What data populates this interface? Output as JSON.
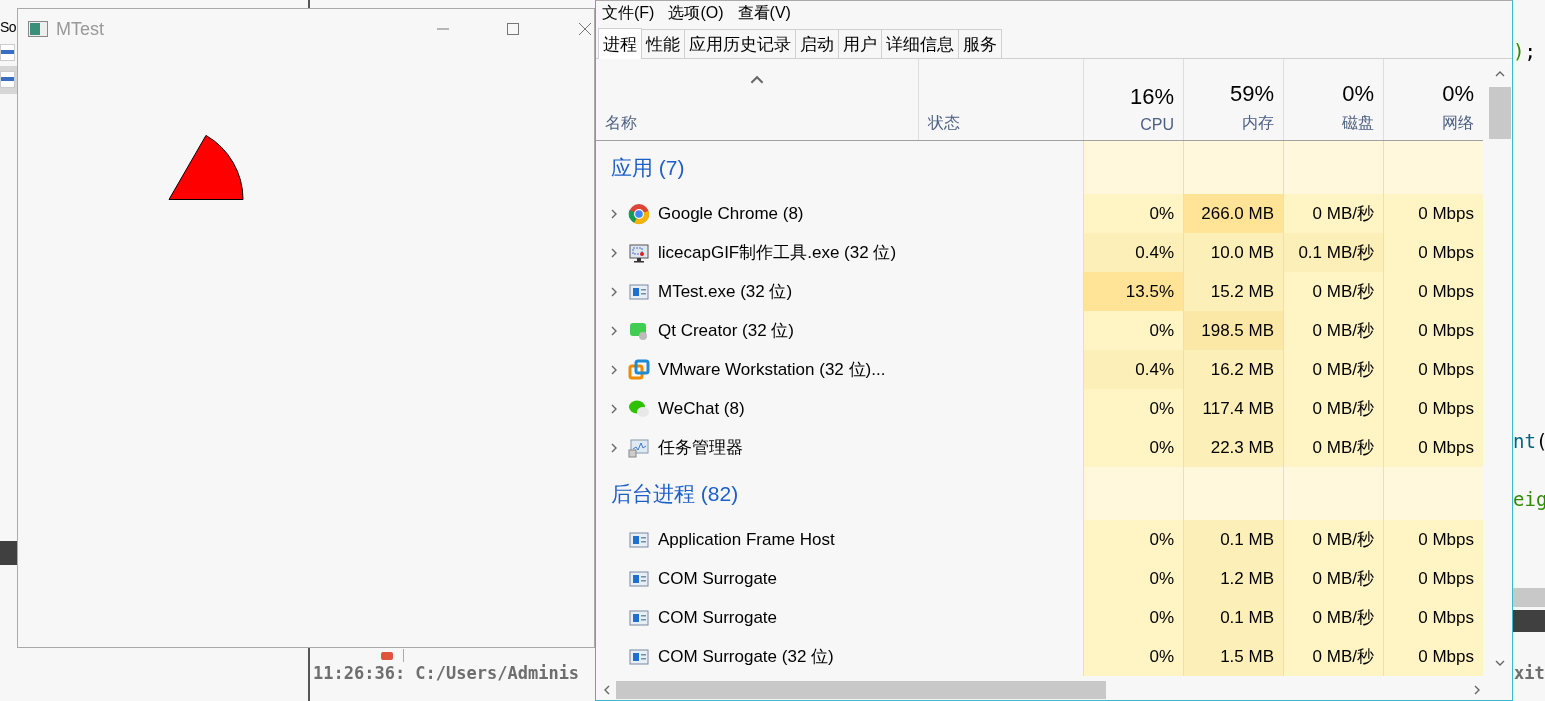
{
  "editor": {
    "sidebar_text": "So",
    "code_lines": [
      {
        "parts": [
          {
            "text": ")",
            "color": "#2e8b00"
          },
          {
            "text": ";",
            "color": "#000000"
          }
        ]
      },
      {
        "parts": [
          {
            "text": "nt",
            "color": "#00677c"
          },
          {
            "text": "(",
            "color": "#000000"
          }
        ]
      },
      {
        "parts": [
          {
            "text": "eig",
            "color": "#2e8b00"
          }
        ]
      }
    ],
    "output_line": "11:26:36: C:/Users/Adminis",
    "output_tail": "xit"
  },
  "mtest_window": {
    "title": "MTest"
  },
  "task_manager": {
    "menu": [
      "文件(F)",
      "选项(O)",
      "查看(V)"
    ],
    "tabs": [
      {
        "label": "进程",
        "selected": true
      },
      {
        "label": "性能",
        "selected": false
      },
      {
        "label": "应用历史记录",
        "selected": false
      },
      {
        "label": "启动",
        "selected": false
      },
      {
        "label": "用户",
        "selected": false
      },
      {
        "label": "详细信息",
        "selected": false
      },
      {
        "label": "服务",
        "selected": false
      }
    ],
    "columns": [
      {
        "label": "名称",
        "sorted": true
      },
      {
        "label": "状态",
        "sorted": false
      },
      {
        "label": "CPU",
        "total": "16%",
        "sorted": false
      },
      {
        "label": "内存",
        "total": "59%",
        "sorted": false
      },
      {
        "label": "磁盘",
        "total": "0%",
        "sorted": false
      },
      {
        "label": "网络",
        "total": "0%",
        "sorted": false
      }
    ],
    "groups": [
      {
        "title": "应用 (7)",
        "rows": [
          {
            "name": "Google Chrome (8)",
            "expandable": true,
            "cells": [
              {
                "text": "0%",
                "color": "#fff4c4"
              },
              {
                "text": "266.0 MB",
                "color": "#ffe497"
              },
              {
                "text": "0 MB/秒",
                "color": "#fff4c4"
              },
              {
                "text": "0 Mbps",
                "color": "#fff4c4"
              }
            ]
          },
          {
            "name": "licecapGIF制作工具.exe (32 位)",
            "expandable": true,
            "cells": [
              {
                "text": "0.4%",
                "color": "#fcefb8"
              },
              {
                "text": "10.0 MB",
                "color": "#fcefb8"
              },
              {
                "text": "0.1 MB/秒",
                "color": "#fcefb8"
              },
              {
                "text": "0 Mbps",
                "color": "#fff4c4"
              }
            ]
          },
          {
            "name": "MTest.exe (32 位)",
            "expandable": true,
            "cells": [
              {
                "text": "13.5%",
                "color": "#ffe497"
              },
              {
                "text": "15.2 MB",
                "color": "#fcefb8"
              },
              {
                "text": "0 MB/秒",
                "color": "#fff4c4"
              },
              {
                "text": "0 Mbps",
                "color": "#fff4c4"
              }
            ]
          },
          {
            "name": "Qt Creator (32 位)",
            "expandable": true,
            "cells": [
              {
                "text": "0%",
                "color": "#fff4c4"
              },
              {
                "text": "198.5 MB",
                "color": "#fbe8a6"
              },
              {
                "text": "0 MB/秒",
                "color": "#fff4c4"
              },
              {
                "text": "0 Mbps",
                "color": "#fff4c4"
              }
            ]
          },
          {
            "name": "VMware Workstation (32 位)...",
            "expandable": true,
            "cells": [
              {
                "text": "0.4%",
                "color": "#fcefb8"
              },
              {
                "text": "16.2 MB",
                "color": "#fcefb8"
              },
              {
                "text": "0 MB/秒",
                "color": "#fff4c4"
              },
              {
                "text": "0 Mbps",
                "color": "#fff4c4"
              }
            ]
          },
          {
            "name": "WeChat (8)",
            "expandable": true,
            "cells": [
              {
                "text": "0%",
                "color": "#fff4c4"
              },
              {
                "text": "117.4 MB",
                "color": "#fcefb8"
              },
              {
                "text": "0 MB/秒",
                "color": "#fff4c4"
              },
              {
                "text": "0 Mbps",
                "color": "#fff4c4"
              }
            ]
          },
          {
            "name": "任务管理器",
            "expandable": true,
            "cells": [
              {
                "text": "0%",
                "color": "#fff4c4"
              },
              {
                "text": "22.3 MB",
                "color": "#fcefb8"
              },
              {
                "text": "0 MB/秒",
                "color": "#fff4c4"
              },
              {
                "text": "0 Mbps",
                "color": "#fff4c4"
              }
            ]
          }
        ]
      },
      {
        "title": "后台进程 (82)",
        "rows": [
          {
            "name": "Application Frame Host",
            "expandable": false,
            "cells": [
              {
                "text": "0%",
                "color": "#fff4c4"
              },
              {
                "text": "0.1 MB",
                "color": "#fcefb8"
              },
              {
                "text": "0 MB/秒",
                "color": "#fff4c4"
              },
              {
                "text": "0 Mbps",
                "color": "#fff4c4"
              }
            ]
          },
          {
            "name": "COM Surrogate",
            "expandable": false,
            "cells": [
              {
                "text": "0%",
                "color": "#fff4c4"
              },
              {
                "text": "1.2 MB",
                "color": "#fcefb8"
              },
              {
                "text": "0 MB/秒",
                "color": "#fff4c4"
              },
              {
                "text": "0 Mbps",
                "color": "#fff4c4"
              }
            ]
          },
          {
            "name": "COM Surrogate",
            "expandable": false,
            "cells": [
              {
                "text": "0%",
                "color": "#fff4c4"
              },
              {
                "text": "0.1 MB",
                "color": "#fcefb8"
              },
              {
                "text": "0 MB/秒",
                "color": "#fff4c4"
              },
              {
                "text": "0 Mbps",
                "color": "#fff4c4"
              }
            ]
          },
          {
            "name": "COM Surrogate (32 位)",
            "expandable": false,
            "cells": [
              {
                "text": "0%",
                "color": "#fff4c4"
              },
              {
                "text": "1.5 MB",
                "color": "#fcefb8"
              },
              {
                "text": "0 MB/秒",
                "color": "#fff4c4"
              },
              {
                "text": "0 Mbps",
                "color": "#fff4c4"
              }
            ]
          }
        ]
      }
    ]
  }
}
